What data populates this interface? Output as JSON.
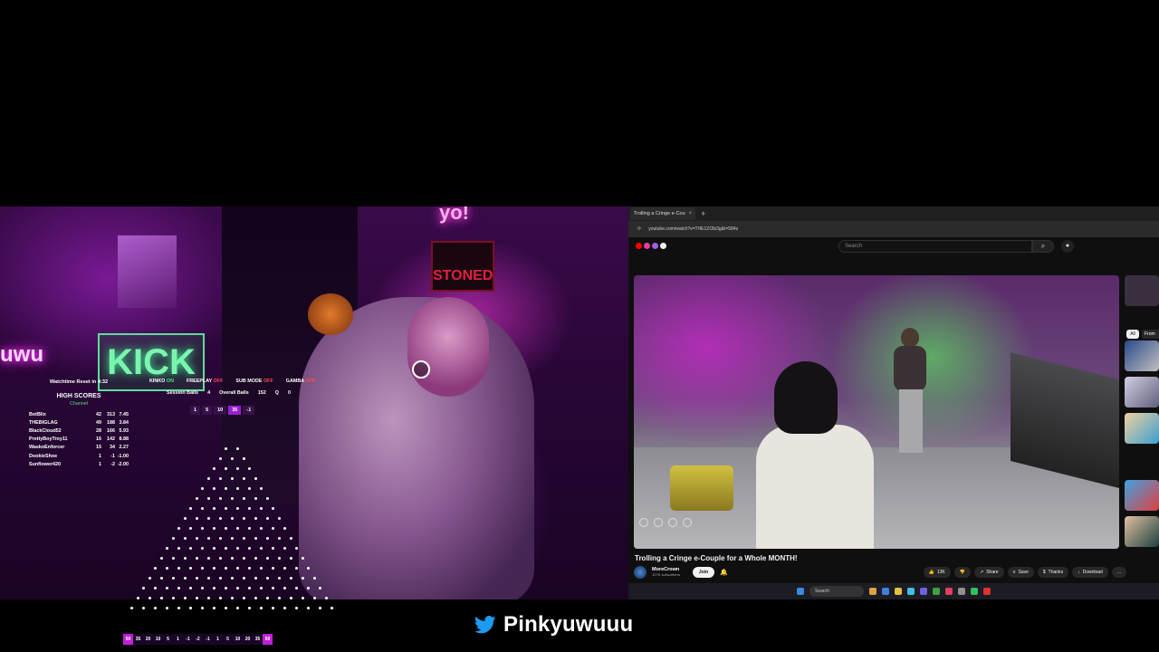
{
  "stream": {
    "twitter_handle": "Pinkyuwuuu",
    "neon_sign_top": "yo!",
    "neon_sign_left": "uwu",
    "neon_sign_kick": "KICK",
    "neon_sign_stoned": "STONED"
  },
  "overlay": {
    "watchtime": "Watchtime Reset in 4:32",
    "high_scores_title": "HIGH SCORES",
    "high_scores_subtitle": "Channel",
    "scores": [
      {
        "name": "BotBlix",
        "a": "42",
        "b": "313",
        "c": "7.45"
      },
      {
        "name": "THEBIGLAG",
        "a": "49",
        "b": "188",
        "c": "3.84"
      },
      {
        "name": "BlackCloud52",
        "a": "28",
        "b": "166",
        "c": "5.93"
      },
      {
        "name": "PrettyBoyTroy11",
        "a": "16",
        "b": "142",
        "b2": "",
        "c": "8.88"
      },
      {
        "name": "WaskoEnforcer",
        "a": "15",
        "b": "34",
        "c": "2.27"
      },
      {
        "name": "DookieShoe",
        "a": "1",
        "b": "-1",
        "c": "-1.00"
      },
      {
        "name": "Sunflower420",
        "a": "1",
        "b": "-2",
        "c": "-2.00"
      }
    ],
    "flags": [
      {
        "label": "KINKO",
        "state": "ON"
      },
      {
        "label": "FREEPLAY",
        "state": "OFF"
      },
      {
        "label": "SUB MODE",
        "state": "OFF"
      },
      {
        "label": "GAMBA",
        "state": "OFF"
      }
    ],
    "session_balls_label": "Session Balls",
    "session_balls": "4",
    "overall_balls_label": "Overall Balls",
    "overall_balls": "152",
    "queue_label": "Q",
    "queue": "0",
    "bet_options": [
      "1",
      "5",
      "10",
      "35",
      "-1"
    ],
    "plinko_slots": [
      "50",
      "35",
      "20",
      "10",
      "5",
      "1",
      "-1",
      "-2",
      "-1",
      "1",
      "5",
      "10",
      "20",
      "35",
      "50"
    ]
  },
  "browser": {
    "tab_title": "Trolling a Cringe e-Cou",
    "tab_close": "×",
    "new_tab": "+",
    "url": "youtube.com/watch?v=THE1ZOlb3g&t=584s",
    "search_placeholder": "Search",
    "search_icon": "search-icon",
    "mic_icon": "mic-icon",
    "video_title": "Trolling a Cringe e-Couple for a Whole MONTH!",
    "channel_name": "MoreCrown",
    "subscribers": "127K subscribers",
    "join_label": "Join",
    "like_count": "13K",
    "share_label": "Share",
    "save_label": "Save",
    "thanks_label": "Thanks",
    "download_label": "Download",
    "more_label": "...",
    "chip_all": "All",
    "chip_from": "From",
    "taskbar_search": "Search"
  },
  "colors": {
    "accent_purple": "#9b1fd0",
    "on_green": "#48e66e",
    "off_red": "#ff4a4a",
    "twitter_blue": "#1d9bf0"
  }
}
